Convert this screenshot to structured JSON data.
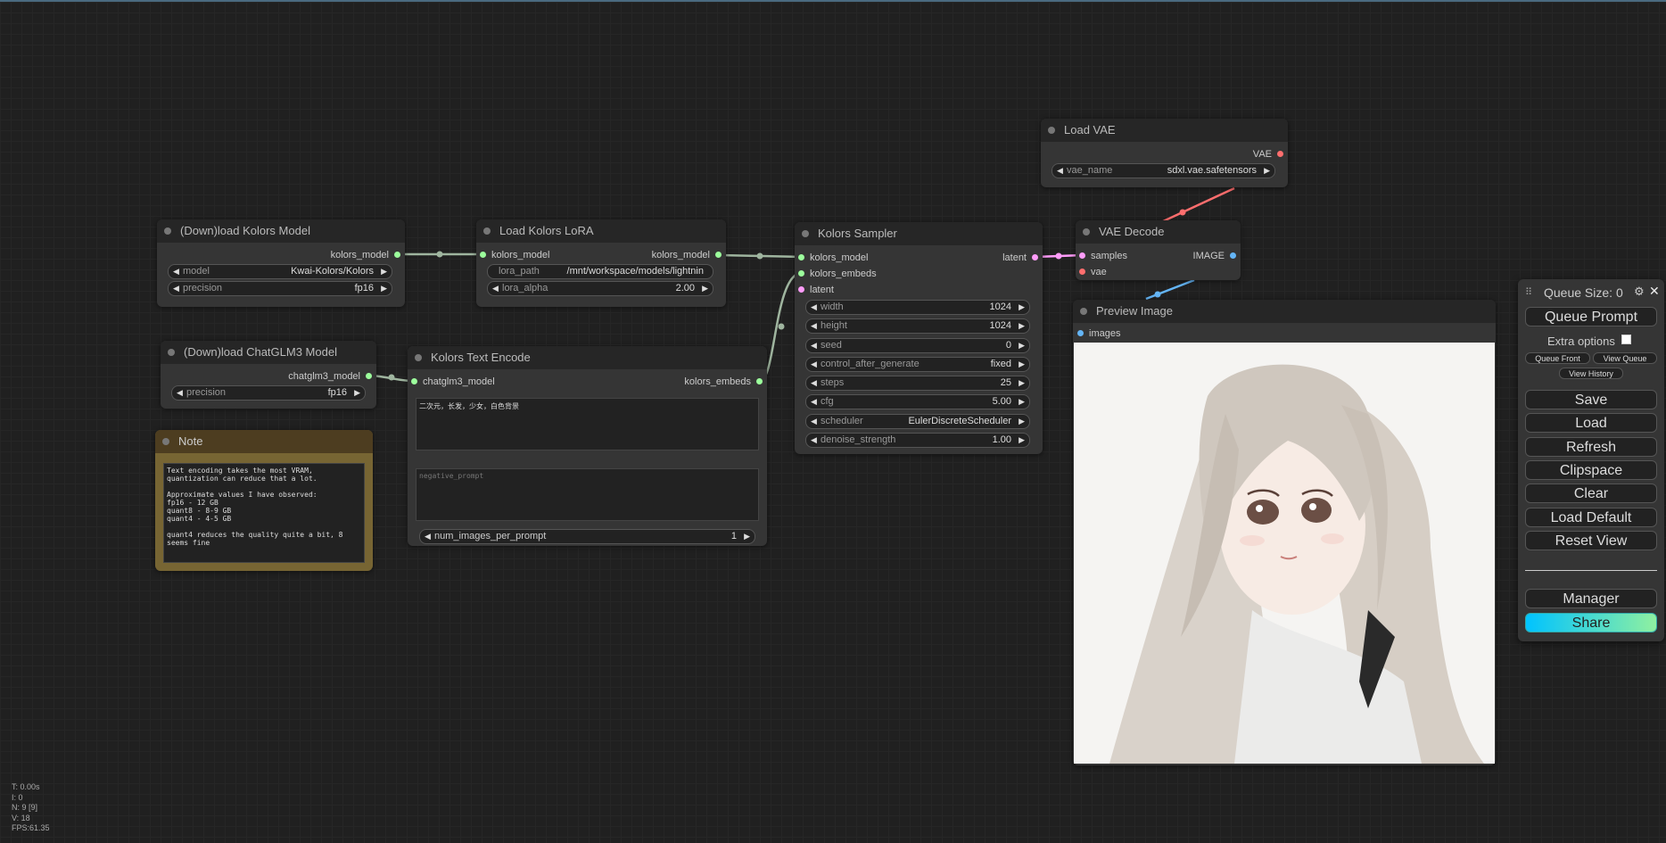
{
  "nodes": {
    "load_kolors_model": {
      "title": "(Down)load Kolors Model",
      "output": "kolors_model",
      "widgets": [
        {
          "label": "model",
          "value": "Kwai-Kolors/Kolors"
        },
        {
          "label": "precision",
          "value": "fp16"
        }
      ]
    },
    "load_kolors_lora": {
      "title": "Load Kolors LoRA",
      "input": "kolors_model",
      "output": "kolors_model",
      "lora_path_label": "lora_path",
      "lora_path_value": "/mnt/workspace/models/lightnin",
      "lora_alpha_label": "lora_alpha",
      "lora_alpha_value": "2.00"
    },
    "load_chatglm3": {
      "title": "(Down)load ChatGLM3 Model",
      "output": "chatglm3_model",
      "precision_label": "precision",
      "precision_value": "fp16"
    },
    "text_encode": {
      "title": "Kolors Text Encode",
      "input": "chatglm3_model",
      "output": "kolors_embeds",
      "prompt": "二次元，长发，少女，白色背景",
      "negative_placeholder": "negative_prompt",
      "num_images_label": "num_images_per_prompt",
      "num_images_value": "1"
    },
    "note": {
      "title": "Note",
      "text": "Text encoding takes the most VRAM, quantization can reduce that a lot.\n\nApproximate values I have observed:\nfp16 - 12 GB\nquant8 - 8-9 GB\nquant4 - 4-5 GB\n\nquant4 reduces the quality quite a bit, 8 seems fine"
    },
    "sampler": {
      "title": "Kolors Sampler",
      "inputs": [
        "kolors_model",
        "kolors_embeds",
        "latent"
      ],
      "output": "latent",
      "widgets": [
        {
          "label": "width",
          "value": "1024"
        },
        {
          "label": "height",
          "value": "1024"
        },
        {
          "label": "seed",
          "value": "0"
        },
        {
          "label": "control_after_generate",
          "value": "fixed"
        },
        {
          "label": "steps",
          "value": "25"
        },
        {
          "label": "cfg",
          "value": "5.00"
        },
        {
          "label": "scheduler",
          "value": "EulerDiscreteScheduler"
        },
        {
          "label": "denoise_strength",
          "value": "1.00"
        }
      ]
    },
    "load_vae": {
      "title": "Load VAE",
      "output": "VAE",
      "vae_name_label": "vae_name",
      "vae_name_value": "sdxl.vae.safetensors"
    },
    "vae_decode": {
      "title": "VAE Decode",
      "input1": "samples",
      "input2": "vae",
      "output": "IMAGE"
    },
    "preview": {
      "title": "Preview Image",
      "input": "images"
    }
  },
  "menu": {
    "queue_size": "Queue Size: 0",
    "queue_prompt": "Queue Prompt",
    "extra_options": "Extra options",
    "queue_front": "Queue Front",
    "view_queue": "View Queue",
    "view_history": "View History",
    "save": "Save",
    "load": "Load",
    "refresh": "Refresh",
    "clipspace": "Clipspace",
    "clear": "Clear",
    "load_default": "Load Default",
    "reset_view": "Reset View",
    "manager": "Manager",
    "share": "Share"
  },
  "stats": {
    "t": "T: 0.00s",
    "i": "I: 0",
    "n": "N: 9 [9]",
    "v": "V: 18",
    "fps": "FPS:61.35"
  },
  "colors": {
    "model_link": "#a9c8a0",
    "embeds_link": "#a9c8a0",
    "latent_link": "#ff9cf9",
    "vae_link": "#ff6e6e",
    "image_link": "#64b5f6",
    "dot_model": "#9cff9c",
    "dot_latent": "#ff9cf9",
    "dot_vae": "#ff6e6e",
    "dot_image": "#64b5f6",
    "share_gradient_start": "#00c3ff",
    "share_gradient_end": "#8ff0a0"
  }
}
